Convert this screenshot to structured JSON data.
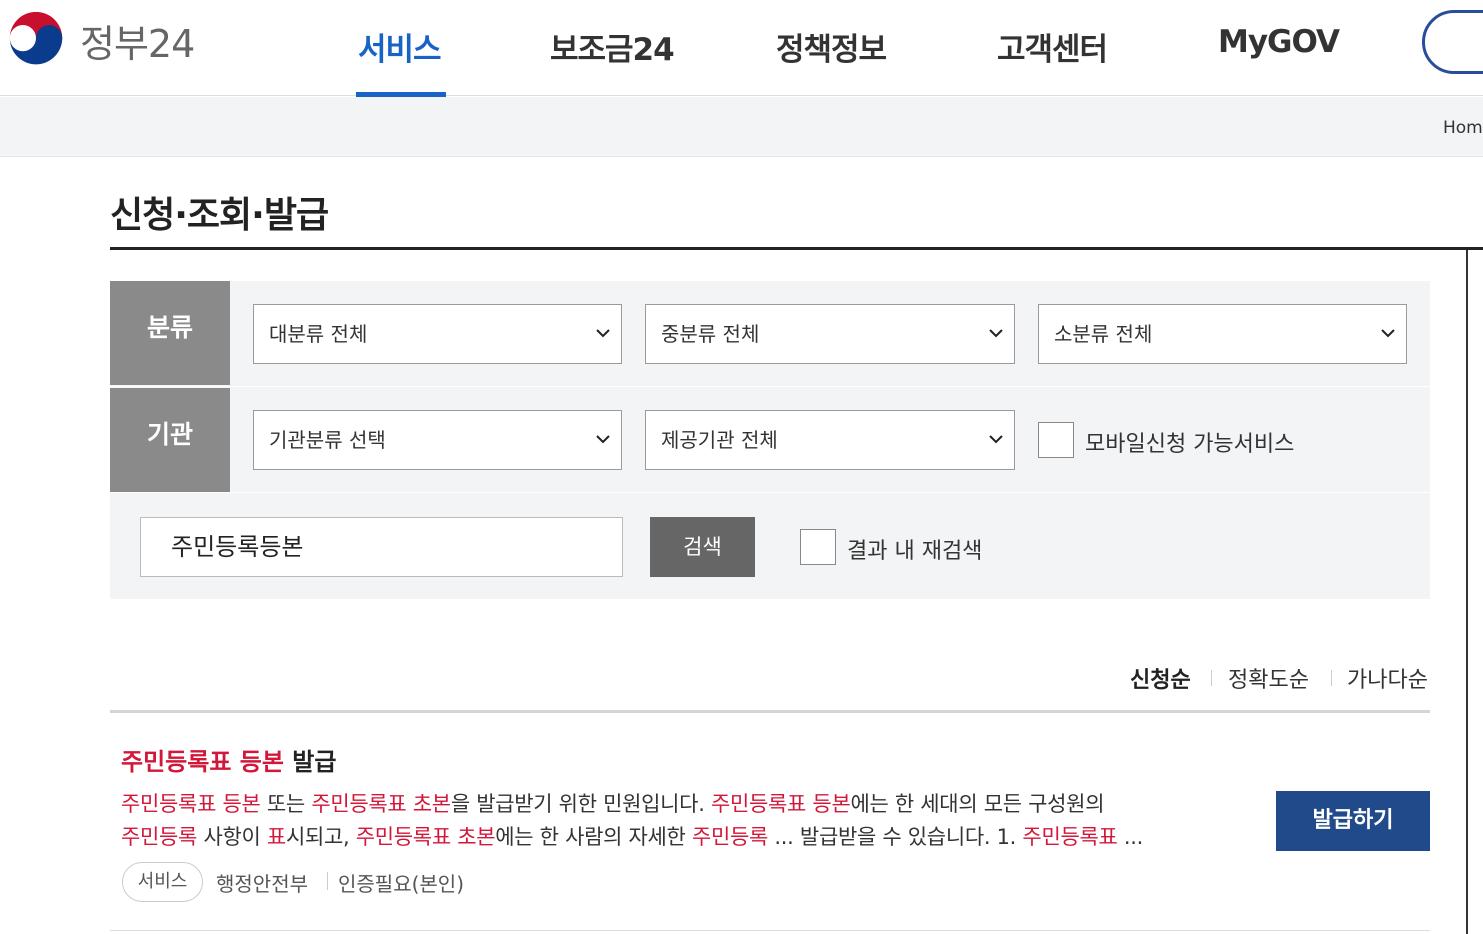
{
  "header": {
    "logo_text": "정부24",
    "nav": [
      {
        "label": "서비스",
        "active": true
      },
      {
        "label": "보조금24",
        "active": false
      },
      {
        "label": "정책정보",
        "active": false
      },
      {
        "label": "고객센터",
        "active": false
      },
      {
        "label": "MyGOV",
        "active": false
      }
    ]
  },
  "breadcrumb": {
    "home": "Home"
  },
  "page": {
    "title": "신청·조회·발급"
  },
  "filter": {
    "category_label": "분류",
    "agency_label": "기관",
    "major_category": "대분류 전체",
    "middle_category": "중분류 전체",
    "minor_category": "소분류 전체",
    "agency_type": "기관분류 선택",
    "provider": "제공기관 전체",
    "mobile_only_label": "모바일신청 가능서비스",
    "search_value": "주민등록등본",
    "search_button": "검색",
    "research_label": "결과 내 재검색"
  },
  "sort": {
    "options": [
      "신청순",
      "정확도순",
      "가나다순"
    ],
    "selected": "신청순"
  },
  "results": [
    {
      "title_highlight": "주민등록표 등본",
      "title_rest": " 발급",
      "desc_line1": [
        {
          "t": "주민등록표 등본",
          "hl": true
        },
        {
          "t": " 또는 ",
          "hl": false
        },
        {
          "t": "주민등록표 초본",
          "hl": true
        },
        {
          "t": "을 발급받기 위한 민원입니다. ",
          "hl": false
        },
        {
          "t": "주민등록표 등본",
          "hl": true
        },
        {
          "t": "에는 한 세대의 모든 구성원의",
          "hl": false
        }
      ],
      "desc_line2": [
        {
          "t": "주민등록",
          "hl": true
        },
        {
          "t": " 사항이 ",
          "hl": false
        },
        {
          "t": "표",
          "hl": true
        },
        {
          "t": "시되고, ",
          "hl": false
        },
        {
          "t": "주민등록표 초본",
          "hl": true
        },
        {
          "t": "에는 한 사람의 자세한 ",
          "hl": false
        },
        {
          "t": "주민등록",
          "hl": true
        },
        {
          "t": " ... 발급받을 수 있습니다. 1. ",
          "hl": false
        },
        {
          "t": "주민등록표",
          "hl": true
        },
        {
          "t": " ...",
          "hl": false
        }
      ],
      "issue_button": "발급하기",
      "tag": "서비스",
      "agency": "행정안전부",
      "auth": "인증필요(본인)"
    }
  ],
  "colors": {
    "brand_blue": "#1a63c6",
    "highlight_red": "#d2173a",
    "button_navy": "#214a8a",
    "label_gray": "#8a8a8a"
  }
}
